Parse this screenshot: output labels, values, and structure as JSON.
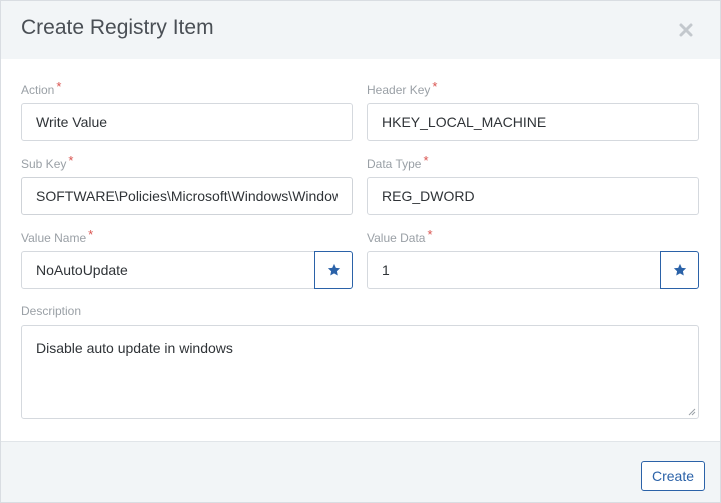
{
  "dialog": {
    "title": "Create Registry Item",
    "close_icon": "close-icon"
  },
  "fields": {
    "action": {
      "label": "Action",
      "required_mark": "*",
      "value": "Write Value"
    },
    "header_key": {
      "label": "Header Key",
      "required_mark": "*",
      "value": "HKEY_LOCAL_MACHINE"
    },
    "sub_key": {
      "label": "Sub Key",
      "required_mark": "*",
      "value": "SOFTWARE\\Policies\\Microsoft\\Windows\\WindowsUpdate\\AU"
    },
    "data_type": {
      "label": "Data Type",
      "required_mark": "*",
      "value": "REG_DWORD"
    },
    "value_name": {
      "label": "Value Name",
      "required_mark": "*",
      "value": "NoAutoUpdate",
      "button_icon": "star-icon"
    },
    "value_data": {
      "label": "Value Data",
      "required_mark": "*",
      "value": "1",
      "button_icon": "star-icon"
    },
    "description": {
      "label": "Description",
      "value": "Disable auto update in windows"
    }
  },
  "footer": {
    "create_label": "Create"
  },
  "colors": {
    "accent": "#2b62a8",
    "required": "#d9534f",
    "header_bg": "#f2f5f7"
  }
}
